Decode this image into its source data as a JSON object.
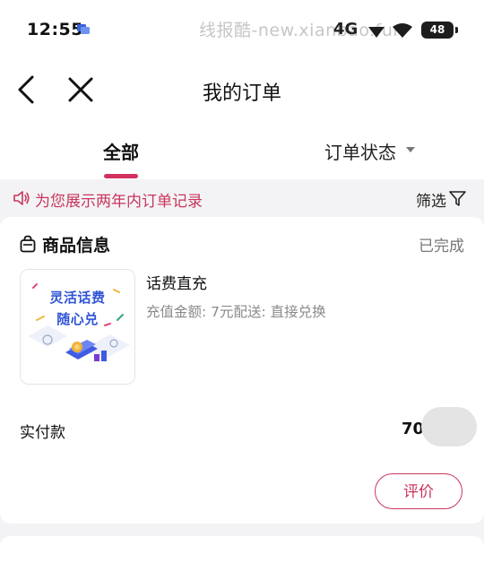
{
  "status_bar": {
    "time": "12:55",
    "watermark": "线报酷-new.xianbao.fun",
    "network": "4G",
    "battery": "48"
  },
  "nav": {
    "title": "我的订单",
    "back_icon": "chevron-left-icon",
    "close_icon": "close-icon"
  },
  "tabs": {
    "all_label": "全部",
    "status_label": "订单状态",
    "active_color": "#d2315f"
  },
  "notice": {
    "text": "为您展示两年内订单记录",
    "filter_label": "筛选",
    "color": "#c8365d"
  },
  "order": {
    "section_title": "商品信息",
    "status": "已完成",
    "thumbnail": {
      "line1": "灵活话费",
      "line2": "随心兑"
    },
    "product_name": "话费直充",
    "product_detail": "充值金额: 7元配送: 直接兑换",
    "pay_label": "实付款",
    "pay_amount": "70",
    "review_label": "评价"
  }
}
